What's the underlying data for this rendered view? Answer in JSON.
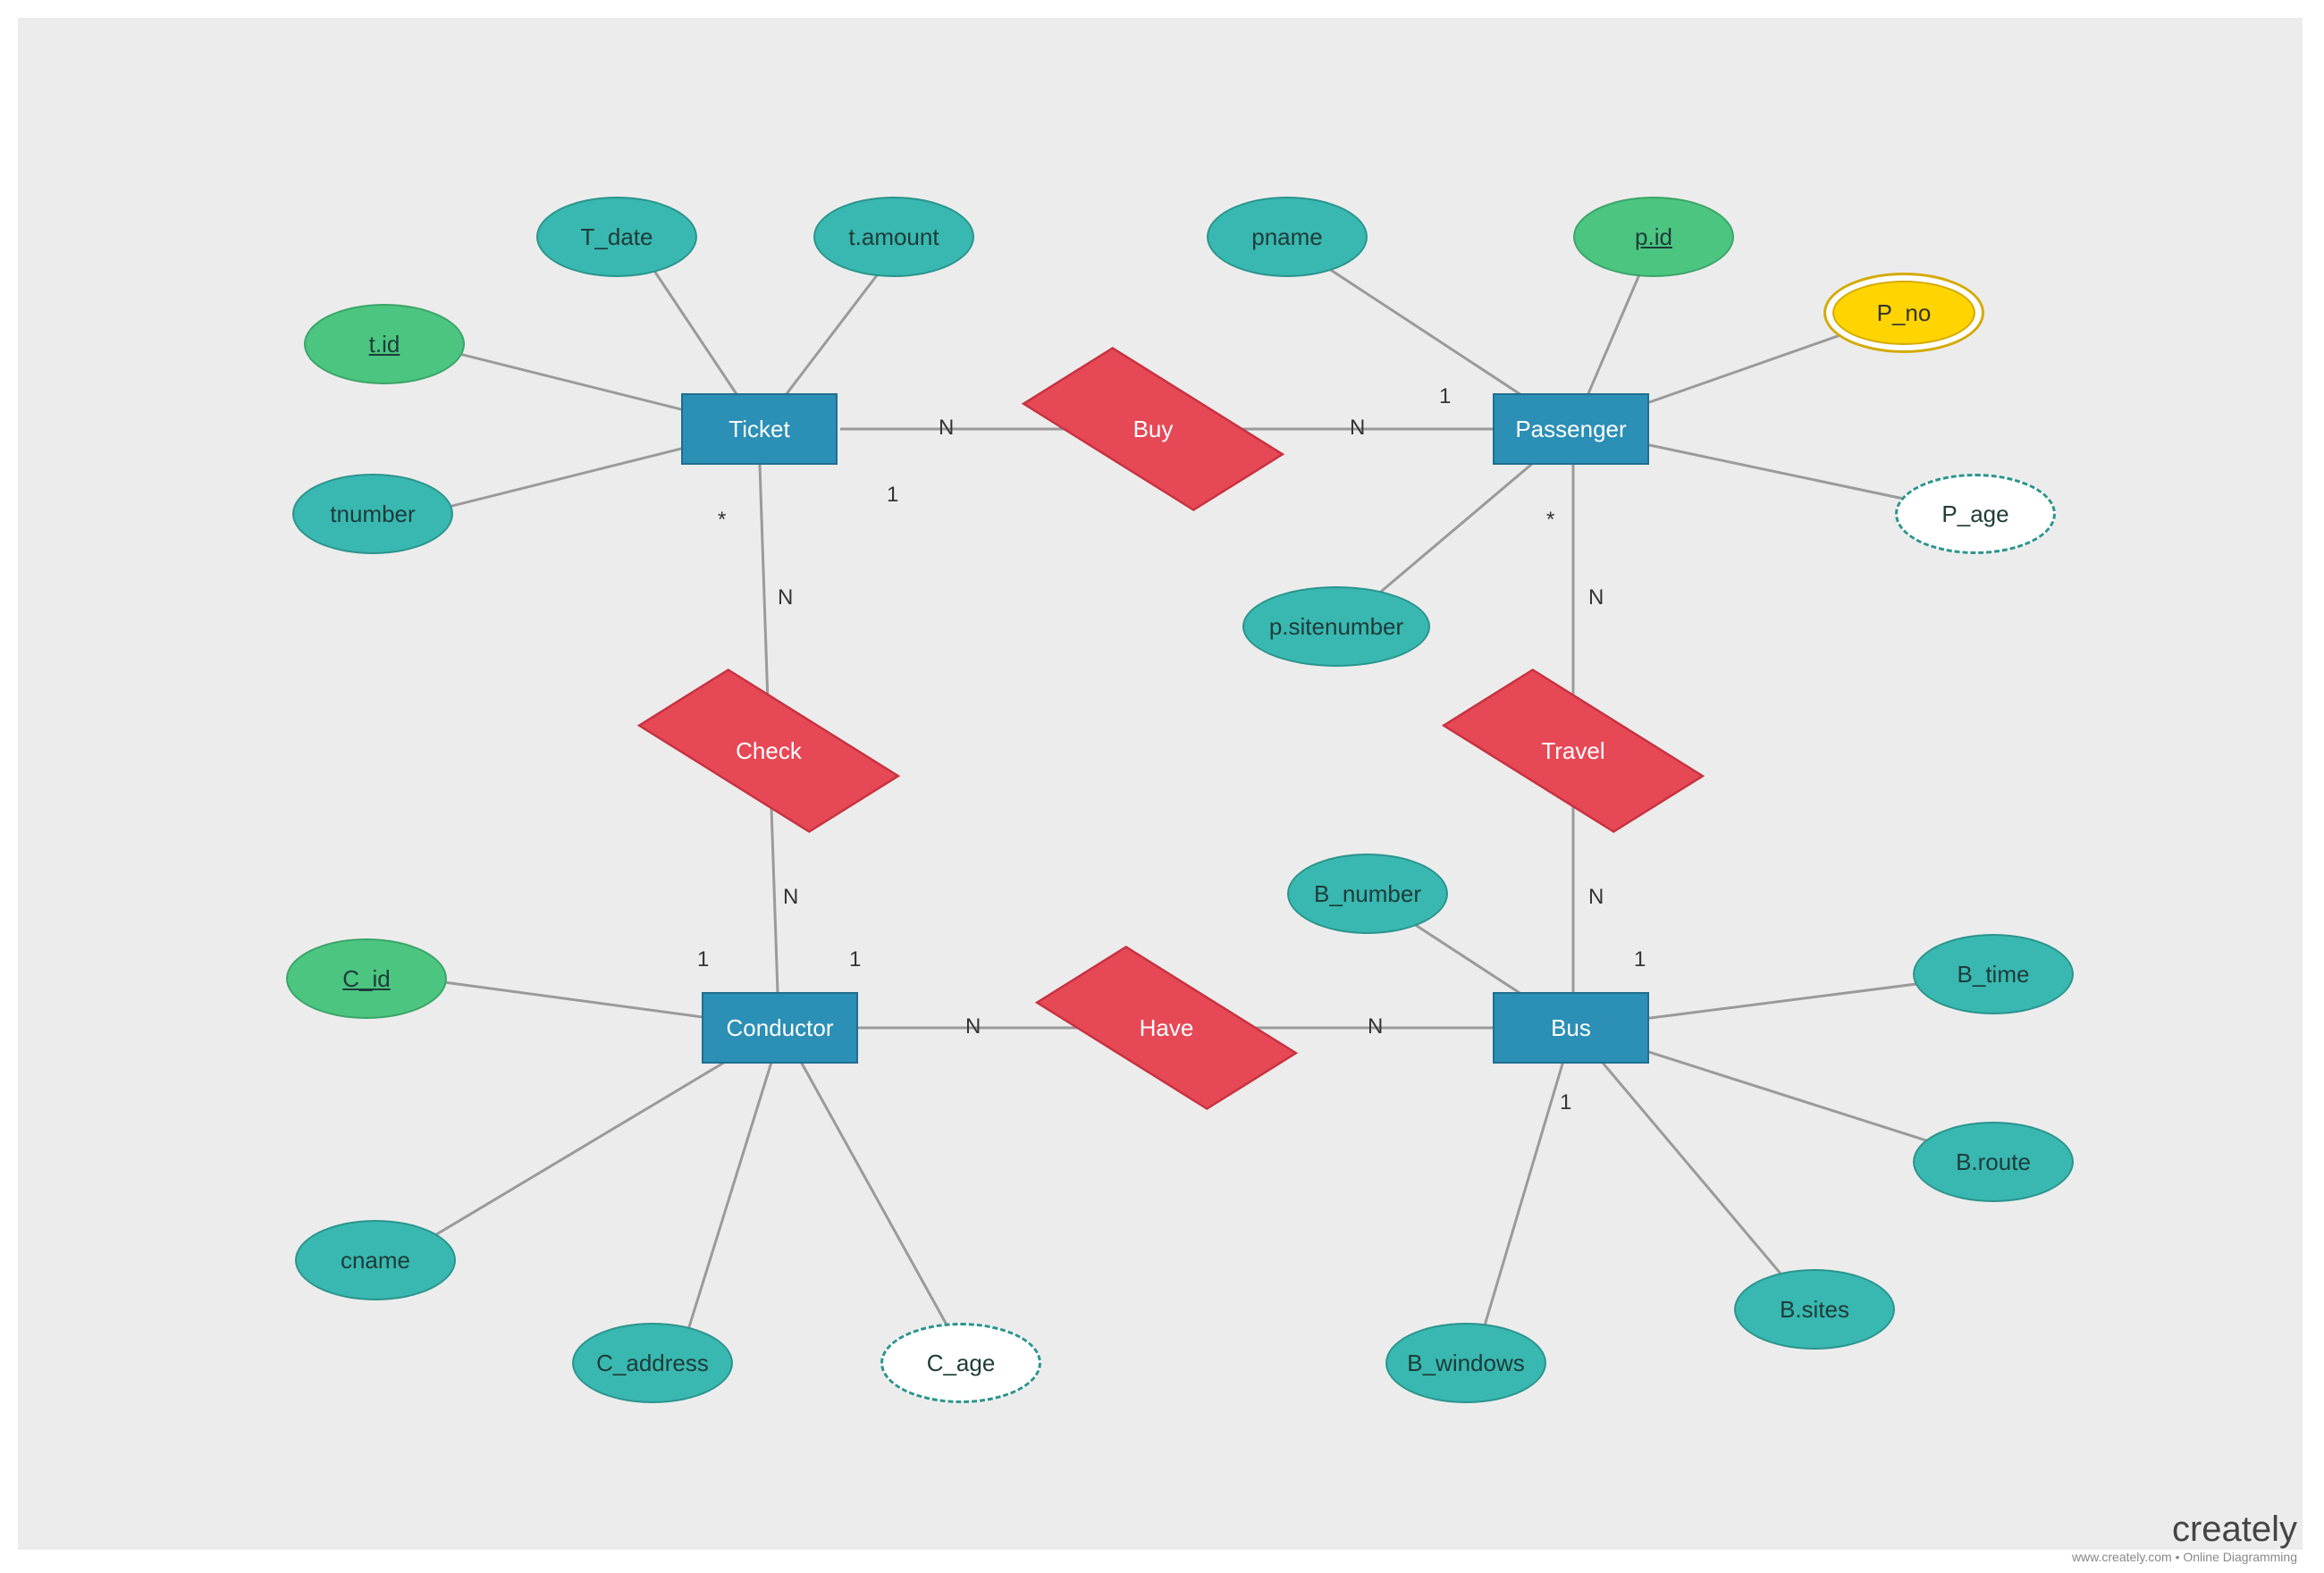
{
  "entities": {
    "ticket": "Ticket",
    "passenger": "Passenger",
    "conductor": "Conductor",
    "bus": "Bus"
  },
  "relationships": {
    "buy": "Buy",
    "check": "Check",
    "have": "Have",
    "travel": "Travel"
  },
  "attributes": {
    "t_id": "t.id",
    "t_date": "T_date",
    "t_amount": "t.amount",
    "tnumber": "tnumber",
    "pname": "pname",
    "p_id": "p.id",
    "p_no": "P_no",
    "p_age": "P_age",
    "p_sitenumber": "p.sitenumber",
    "c_id": "C_id",
    "cname": "cname",
    "c_address": "C_address",
    "c_age": "C_age",
    "b_number": "B_number",
    "b_time": "B_time",
    "b_route": "B.route",
    "b_sites": "B.sites",
    "b_windows": "B_windows"
  },
  "cardinality": {
    "n": "N",
    "one": "1",
    "star": "*"
  },
  "branding": {
    "name": "creately",
    "tagline": "www.creately.com • Online Diagramming"
  },
  "chart_data": {
    "type": "er-diagram",
    "entities": [
      {
        "name": "Ticket",
        "attributes": [
          {
            "name": "t.id",
            "key": true
          },
          {
            "name": "T_date"
          },
          {
            "name": "t.amount"
          },
          {
            "name": "tnumber"
          }
        ]
      },
      {
        "name": "Passenger",
        "attributes": [
          {
            "name": "pname"
          },
          {
            "name": "p.id",
            "key": true
          },
          {
            "name": "P_no",
            "multivalued": true
          },
          {
            "name": "P_age",
            "derived": true
          },
          {
            "name": "p.sitenumber"
          }
        ]
      },
      {
        "name": "Conductor",
        "attributes": [
          {
            "name": "C_id",
            "key": true
          },
          {
            "name": "cname"
          },
          {
            "name": "C_address"
          },
          {
            "name": "C_age",
            "derived": true
          }
        ]
      },
      {
        "name": "Bus",
        "attributes": [
          {
            "name": "B_number"
          },
          {
            "name": "B_time"
          },
          {
            "name": "B.route"
          },
          {
            "name": "B.sites"
          },
          {
            "name": "B_windows"
          }
        ]
      }
    ],
    "relationships": [
      {
        "name": "Buy",
        "between": [
          "Ticket",
          "Passenger"
        ],
        "cardinality": [
          "N",
          "N"
        ],
        "participation_labels": [
          "1",
          "1"
        ]
      },
      {
        "name": "Check",
        "between": [
          "Ticket",
          "Conductor"
        ],
        "cardinality": [
          "N",
          "N"
        ],
        "participation_labels": [
          "1",
          "1"
        ]
      },
      {
        "name": "Have",
        "between": [
          "Conductor",
          "Bus"
        ],
        "cardinality": [
          "N",
          "N"
        ],
        "participation_labels": [
          "1",
          "1"
        ]
      },
      {
        "name": "Travel",
        "between": [
          "Passenger",
          "Bus"
        ],
        "cardinality": [
          "N",
          "N"
        ],
        "participation_labels": [
          "*",
          "1"
        ]
      }
    ]
  }
}
